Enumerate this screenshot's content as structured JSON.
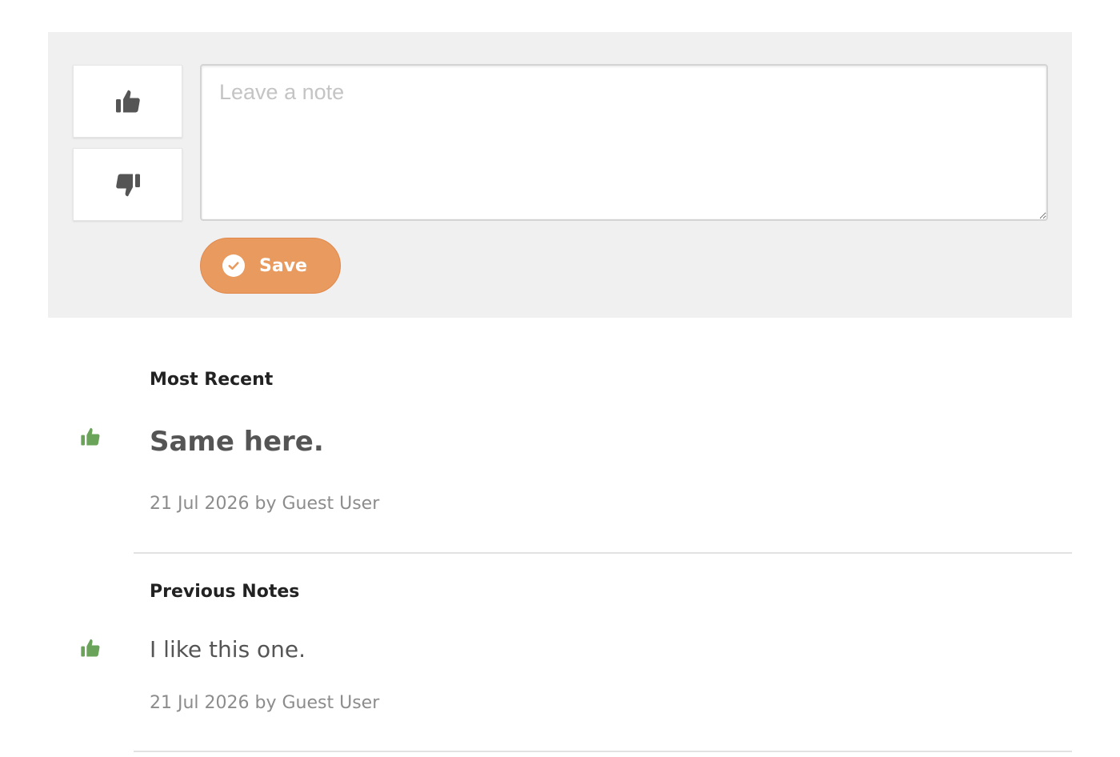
{
  "editor": {
    "note_placeholder": "Leave a note",
    "save_label": "Save",
    "accent_color": "#e99a5f"
  },
  "icons": {
    "vote_up": "thumbs-up-icon",
    "vote_down": "thumbs-down-icon",
    "save": "check-circle-icon",
    "positive_vote": "thumbs-up-icon"
  },
  "colors": {
    "positive": "#6aa35a",
    "vote_icon": "#555555"
  },
  "recent": {
    "heading": "Most Recent",
    "note": {
      "text": "Same here.",
      "meta": "21 Jul 2026 by Guest User"
    }
  },
  "previous": {
    "heading": "Previous Notes",
    "notes": [
      {
        "text": "I like this one.",
        "meta": "21 Jul 2026 by Guest User"
      }
    ]
  }
}
